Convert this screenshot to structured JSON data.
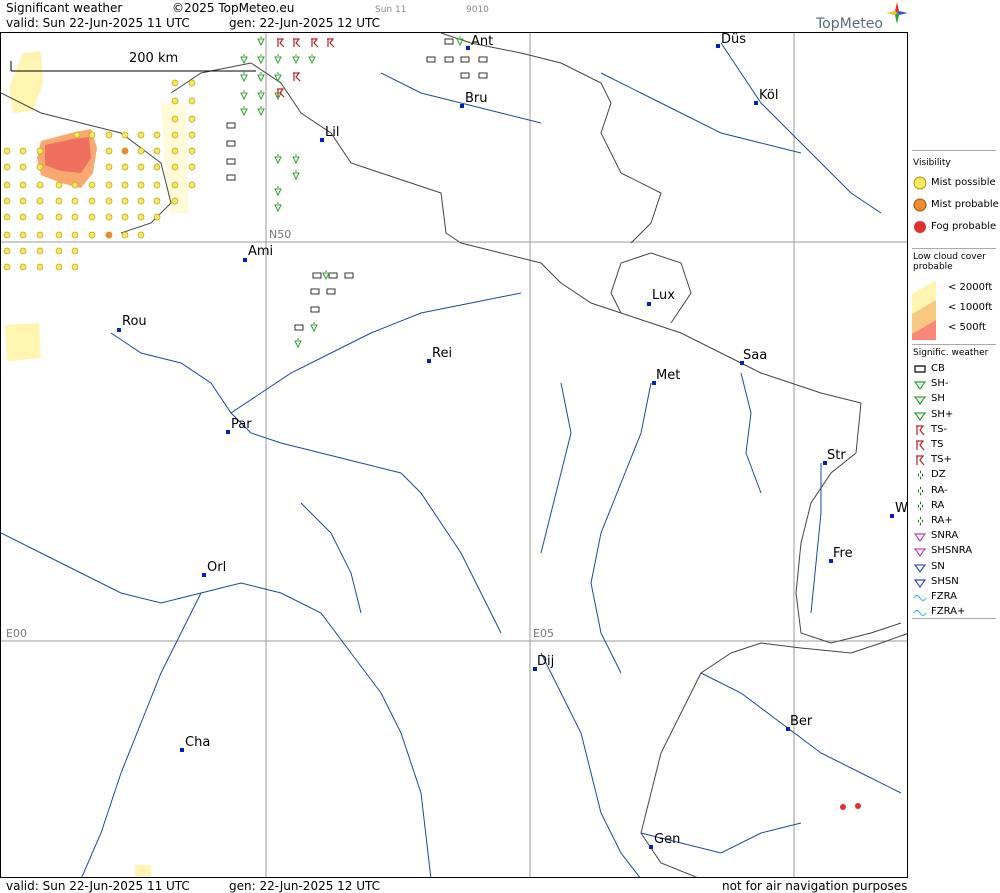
{
  "header": {
    "title": "Significant weather",
    "copyright": "©2025 TopMeteo.eu",
    "valid": "valid:  Sun  22-Jun-2025  11 UTC",
    "gen": "gen: 22-Jun-2025 12 UTC",
    "time_code": "Sun 11",
    "code": "9010",
    "logo": "TopMeteo"
  },
  "scale": {
    "label": "200 km"
  },
  "grid_labels": {
    "n50": "N50",
    "e00": "E00",
    "e05": "E05"
  },
  "cities": [
    {
      "name": "Ant",
      "key": "ant"
    },
    {
      "name": "Düs",
      "key": "dus"
    },
    {
      "name": "Köl",
      "key": "kol"
    },
    {
      "name": "Bru",
      "key": "bru"
    },
    {
      "name": "Lil",
      "key": "lil"
    },
    {
      "name": "Ami",
      "key": "ami"
    },
    {
      "name": "Lux",
      "key": "lux"
    },
    {
      "name": "Rou",
      "key": "rou"
    },
    {
      "name": "Saa",
      "key": "saa"
    },
    {
      "name": "Rei",
      "key": "rei"
    },
    {
      "name": "Met",
      "key": "met"
    },
    {
      "name": "Par",
      "key": "par"
    },
    {
      "name": "Str",
      "key": "str"
    },
    {
      "name": "W",
      "key": "w"
    },
    {
      "name": "Fre",
      "key": "fre"
    },
    {
      "name": "Orl",
      "key": "orl"
    },
    {
      "name": "Dij",
      "key": "dij"
    },
    {
      "name": "Ber",
      "key": "ber"
    },
    {
      "name": "Cha",
      "key": "cha"
    },
    {
      "name": "Gen",
      "key": "gen"
    }
  ],
  "legend": {
    "visibility_title": "Visibility",
    "mist_possible": "Mist possible",
    "mist_probable": "Mist probable",
    "fog_probable": "Fog probable",
    "low_cloud_title": "Low cloud cover probable",
    "lc_2000": "< 2000ft",
    "lc_1000": "< 1000ft",
    "lc_500": "<   500ft",
    "sigwx_title": "Signific. weather",
    "items": [
      "CB",
      "SH-",
      "SH",
      "SH+",
      "TS-",
      "TS",
      "TS+",
      "DZ",
      "RA-",
      "RA",
      "RA+",
      "SNRA",
      "SHSNRA",
      "SN",
      "SHSN",
      "FZRA",
      "FZRA+"
    ],
    "colors": {
      "mist_possible": "#f5e85a",
      "mist_probable": "#f08a30",
      "fog": "#e03030",
      "lc_2000": "#fff5b0",
      "lc_1000": "#f8c880",
      "lc_500": "#f88878",
      "shower": "#30a030",
      "ts": "#c02020",
      "ra": "#1a6a1a",
      "sn": "#c040c0",
      "shsn": "#3050d0",
      "fzra": "#40c0e0",
      "river": "#1a4a9a",
      "border": "#444444",
      "city": "#0020c0"
    }
  },
  "footer": {
    "valid": "valid:  Sun  22-Jun-2025  11 UTC",
    "gen": "gen: 22-Jun-2025 12 UTC",
    "note": "not for air navigation purposes"
  }
}
